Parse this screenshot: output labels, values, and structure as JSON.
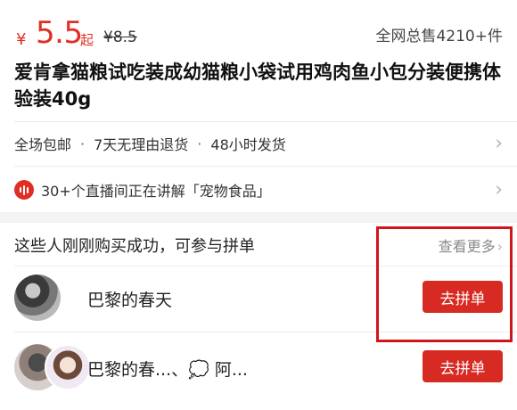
{
  "product": {
    "currency_symbol": "¥",
    "price": "5.5",
    "price_suffix": "起",
    "original_price": "¥8.5",
    "sold_count_text": "全网总售4210+件",
    "title": "爱肯拿猫粮试吃装成幼猫粮小袋试用鸡肉鱼小包分装便携体验装40g"
  },
  "services": {
    "items": [
      "全场包邮",
      "7天无理由退货",
      "48小时发货"
    ],
    "separator": "·"
  },
  "live": {
    "text": "30+个直播间正在讲解「宠物食品」",
    "icon": "live-broadcast-icon",
    "icon_color": "#e02e24"
  },
  "group_buy": {
    "header": "这些人刚刚购买成功，可参与拼单",
    "more_label": "查看更多",
    "buyers": [
      {
        "name": "巴黎的春天",
        "button_label": "去拼单"
      },
      {
        "name": "巴黎的春...、💭 阿...",
        "button_label": "去拼单"
      }
    ]
  },
  "colors": {
    "accent": "#e02e24",
    "button": "#d72a22",
    "highlight_box": "#d0161c"
  },
  "icons": {
    "chevron": "chevron-right-icon"
  }
}
